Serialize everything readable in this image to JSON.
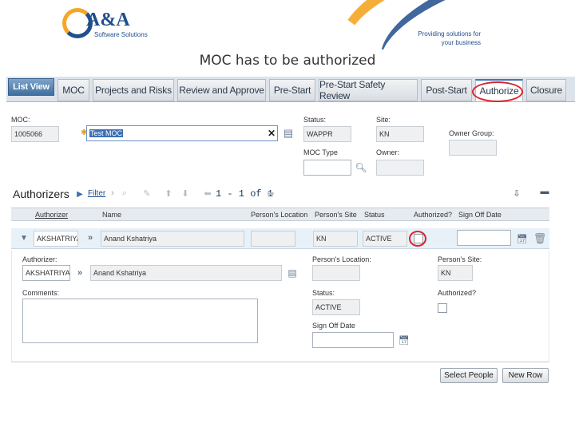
{
  "banner": {
    "company": "A&A",
    "company_sub": "Software Solutions",
    "tagline_1": "Providing solutions for",
    "tagline_2": "your business"
  },
  "slide_title": "MOC has to be authorized",
  "tabs": [
    "List View",
    "MOC",
    "Projects and Risks",
    "Review and Approve",
    "Pre-Start",
    "Pre-Start Safety Review",
    "Post-Start",
    "Authorize",
    "Closure"
  ],
  "active_tab": "Authorize",
  "form": {
    "moc_label": "MOC:",
    "moc_value": "1005066",
    "description_value": "Test MOC",
    "status_label": "Status:",
    "status_value": "WAPPR",
    "site_label": "Site:",
    "site_value": "KN",
    "owner_group_label": "Owner Group:",
    "owner_group_value": "",
    "moc_type_label": "MOC Type",
    "moc_type_value": "",
    "owner_label": "Owner:",
    "owner_value": ""
  },
  "authorizers": {
    "title": "Authorizers",
    "filter_label": "Filter",
    "pager": "1 - 1 of 1",
    "columns": [
      "Authorizer",
      "Name",
      "Person's Location",
      "Person's Site",
      "Status",
      "Authorized?",
      "Sign Off Date"
    ],
    "row": {
      "authorizer": "AKSHATRIYA",
      "name": "Anand Kshatriya",
      "location": "",
      "site": "KN",
      "status": "ACTIVE",
      "authorized": false,
      "sign_off_date": ""
    },
    "detail": {
      "authorizer_label": "Authorizer:",
      "authorizer_value": "AKSHATRIYA",
      "name_value": "Anand Kshatriya",
      "location_label": "Person's Location:",
      "location_value": "",
      "site_label": "Person's Site:",
      "site_value": "KN",
      "comments_label": "Comments:",
      "comments_value": "",
      "status_label": "Status:",
      "status_value": "ACTIVE",
      "authorized_label": "Authorized?",
      "authorized": false,
      "sign_off_label": "Sign Off Date",
      "sign_off_value": ""
    },
    "buttons": {
      "select_people": "Select People",
      "new_row": "New Row"
    }
  },
  "colors": {
    "accent_blue": "#1f4e8c",
    "accent_orange": "#f5a623",
    "highlight_circle": "#d9262c"
  }
}
